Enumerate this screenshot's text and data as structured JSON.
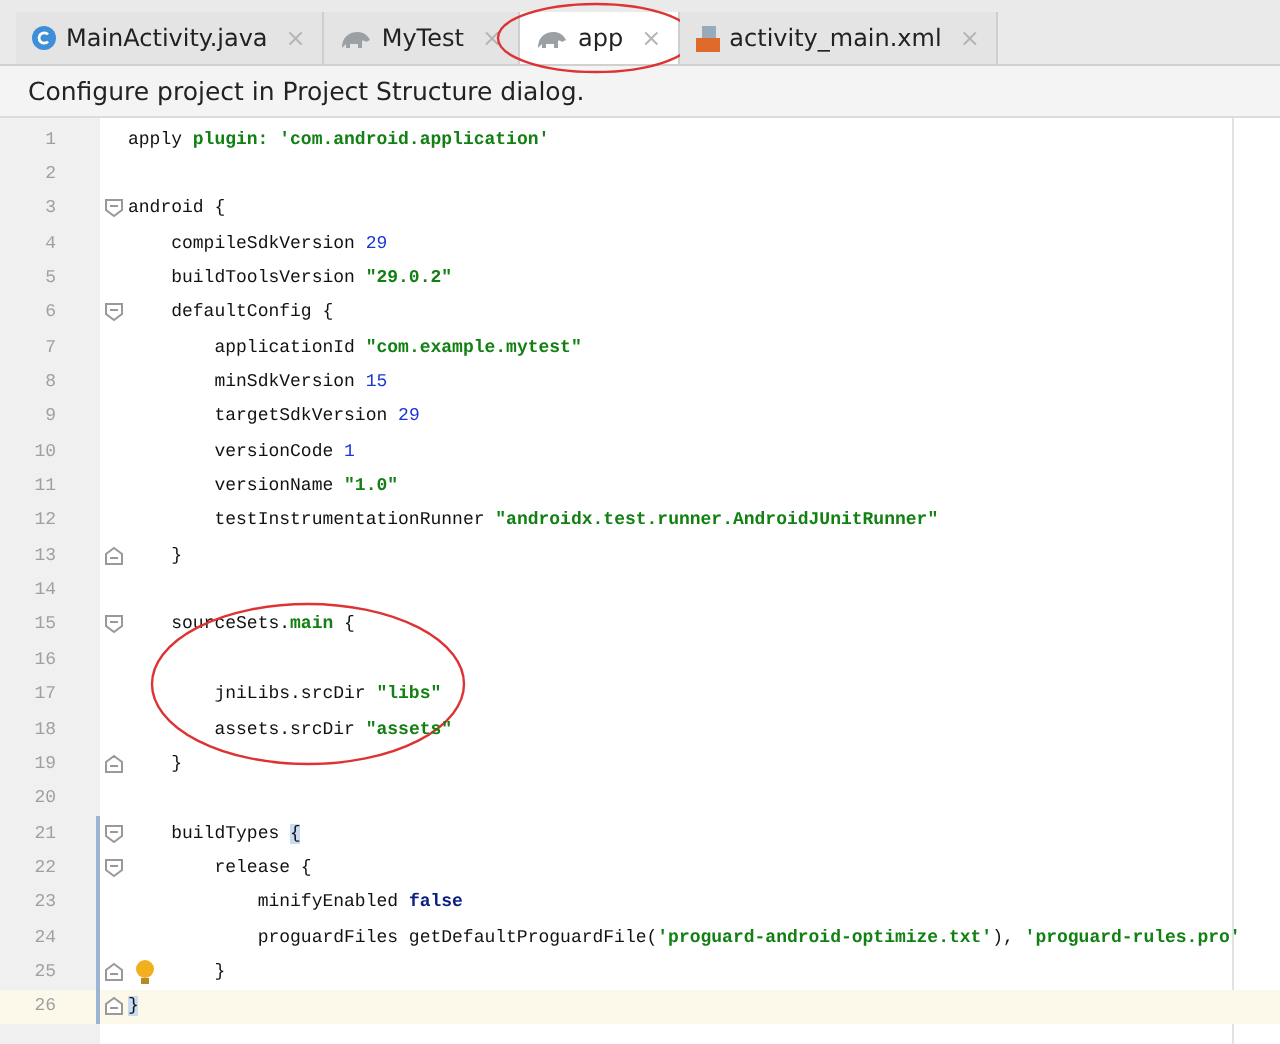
{
  "tabs": [
    {
      "label": "MainActivity.java",
      "kind": "java",
      "selected": false,
      "circled": false,
      "close": "×"
    },
    {
      "label": "MyTest",
      "kind": "gradle",
      "selected": false,
      "circled": false,
      "close": "×"
    },
    {
      "label": "app",
      "kind": "gradle",
      "selected": true,
      "circled": true,
      "close": "×"
    },
    {
      "label": "activity_main.xml",
      "kind": "xml",
      "selected": false,
      "circled": false,
      "close": "×"
    }
  ],
  "notification": {
    "text": "Configure project in Project Structure dialog."
  },
  "editor": {
    "lines": [
      {
        "number": "1",
        "kind": "plain",
        "changed": false,
        "current": false,
        "circled": false,
        "tokens": [
          {
            "kind": "plain",
            "text": "apply "
          },
          {
            "kind": "named",
            "text": "plugin: "
          },
          {
            "kind": "string",
            "text": "'com.android.application'"
          }
        ]
      },
      {
        "number": "2",
        "kind": "plain",
        "changed": false,
        "current": false,
        "circled": false
      },
      {
        "number": "3",
        "kind": "open",
        "changed": false,
        "current": false,
        "circled": false,
        "tokens": [
          {
            "kind": "plain",
            "text": "android {"
          }
        ]
      },
      {
        "number": "4",
        "kind": "plain",
        "changed": false,
        "current": false,
        "circled": false,
        "tokens": [
          {
            "kind": "plain",
            "text": "    compileSdkVersion "
          },
          {
            "kind": "number",
            "text": "29"
          }
        ]
      },
      {
        "number": "5",
        "kind": "plain",
        "changed": false,
        "current": false,
        "circled": false,
        "tokens": [
          {
            "kind": "plain",
            "text": "    buildToolsVersion "
          },
          {
            "kind": "string",
            "text": "\"29.0.2\""
          }
        ]
      },
      {
        "number": "6",
        "kind": "open",
        "changed": false,
        "current": false,
        "circled": false,
        "tokens": [
          {
            "kind": "plain",
            "text": "    defaultConfig {"
          }
        ]
      },
      {
        "number": "7",
        "kind": "plain",
        "changed": false,
        "current": false,
        "circled": false,
        "tokens": [
          {
            "kind": "plain",
            "text": "        applicationId "
          },
          {
            "kind": "string",
            "text": "\"com.example.mytest\""
          }
        ]
      },
      {
        "number": "8",
        "kind": "plain",
        "changed": false,
        "current": false,
        "circled": false,
        "tokens": [
          {
            "kind": "plain",
            "text": "        minSdkVersion "
          },
          {
            "kind": "number",
            "text": "15"
          }
        ]
      },
      {
        "number": "9",
        "kind": "plain",
        "changed": false,
        "current": false,
        "circled": false,
        "tokens": [
          {
            "kind": "plain",
            "text": "        targetSdkVersion "
          },
          {
            "kind": "number",
            "text": "29"
          }
        ]
      },
      {
        "number": "10",
        "kind": "plain",
        "changed": false,
        "current": false,
        "circled": false,
        "tokens": [
          {
            "kind": "plain",
            "text": "        versionCode "
          },
          {
            "kind": "number",
            "text": "1"
          }
        ]
      },
      {
        "number": "11",
        "kind": "plain",
        "changed": false,
        "current": false,
        "circled": false,
        "tokens": [
          {
            "kind": "plain",
            "text": "        versionName "
          },
          {
            "kind": "string",
            "text": "\"1.0\""
          }
        ]
      },
      {
        "number": "12",
        "kind": "plain",
        "changed": false,
        "current": false,
        "circled": false,
        "tokens": [
          {
            "kind": "plain",
            "text": "        testInstrumentationRunner "
          },
          {
            "kind": "string",
            "text": "\"androidx.test.runner.AndroidJUnitRunner\""
          }
        ]
      },
      {
        "number": "13",
        "kind": "close",
        "changed": false,
        "current": false,
        "circled": false,
        "tokens": [
          {
            "kind": "plain",
            "text": "    }"
          }
        ]
      },
      {
        "number": "14",
        "kind": "plain",
        "changed": false,
        "current": false,
        "circled": false
      },
      {
        "number": "15",
        "kind": "open",
        "changed": false,
        "current": false,
        "circled": true,
        "tokens": [
          {
            "kind": "plain",
            "text": "    sourceSets."
          },
          {
            "kind": "named",
            "text": "main"
          },
          {
            "kind": "plain",
            "text": " {"
          }
        ]
      },
      {
        "number": "16",
        "kind": "plain",
        "changed": false,
        "current": false,
        "circled": false
      },
      {
        "number": "17",
        "kind": "plain",
        "changed": false,
        "current": false,
        "circled": false,
        "tokens": [
          {
            "kind": "plain",
            "text": "        jniLibs.srcDir "
          },
          {
            "kind": "string",
            "text": "\"libs\""
          }
        ]
      },
      {
        "number": "18",
        "kind": "plain",
        "changed": false,
        "current": false,
        "circled": false,
        "tokens": [
          {
            "kind": "plain",
            "text": "        assets.srcDir "
          },
          {
            "kind": "string",
            "text": "\"assets\""
          }
        ]
      },
      {
        "number": "19",
        "kind": "close",
        "changed": false,
        "current": false,
        "circled": false,
        "tokens": [
          {
            "kind": "plain",
            "text": "    }"
          }
        ]
      },
      {
        "number": "20",
        "kind": "plain",
        "changed": false,
        "current": false,
        "circled": false
      },
      {
        "number": "21",
        "kind": "open",
        "changed": true,
        "current": false,
        "circled": false,
        "tokens": [
          {
            "kind": "plain",
            "text": "    buildTypes "
          },
          {
            "kind": "brace",
            "text": "{"
          }
        ]
      },
      {
        "number": "22",
        "kind": "open",
        "changed": true,
        "current": false,
        "circled": false,
        "tokens": [
          {
            "kind": "plain",
            "text": "        release {"
          }
        ]
      },
      {
        "number": "23",
        "kind": "plain",
        "changed": true,
        "current": false,
        "circled": false,
        "tokens": [
          {
            "kind": "plain",
            "text": "            minifyEnabled "
          },
          {
            "kind": "keyword",
            "text": "false"
          }
        ]
      },
      {
        "number": "24",
        "kind": "plain",
        "changed": true,
        "current": false,
        "circled": false,
        "tokens": [
          {
            "kind": "plain",
            "text": "            proguardFiles getDefaultProguardFile("
          },
          {
            "kind": "string",
            "text": "'proguard-android-optimize.txt'"
          },
          {
            "kind": "plain",
            "text": "), "
          },
          {
            "kind": "string",
            "text": "'proguard-rules.pro'"
          }
        ]
      },
      {
        "number": "25",
        "kind": "close",
        "changed": true,
        "current": false,
        "circled": false,
        "bulb": true,
        "tokens": [
          {
            "kind": "plain",
            "text": "        }"
          }
        ]
      },
      {
        "number": "26",
        "kind": "close",
        "changed": true,
        "current": true,
        "circled": false,
        "tokens": [
          {
            "kind": "brace",
            "text": "}"
          }
        ]
      }
    ]
  }
}
